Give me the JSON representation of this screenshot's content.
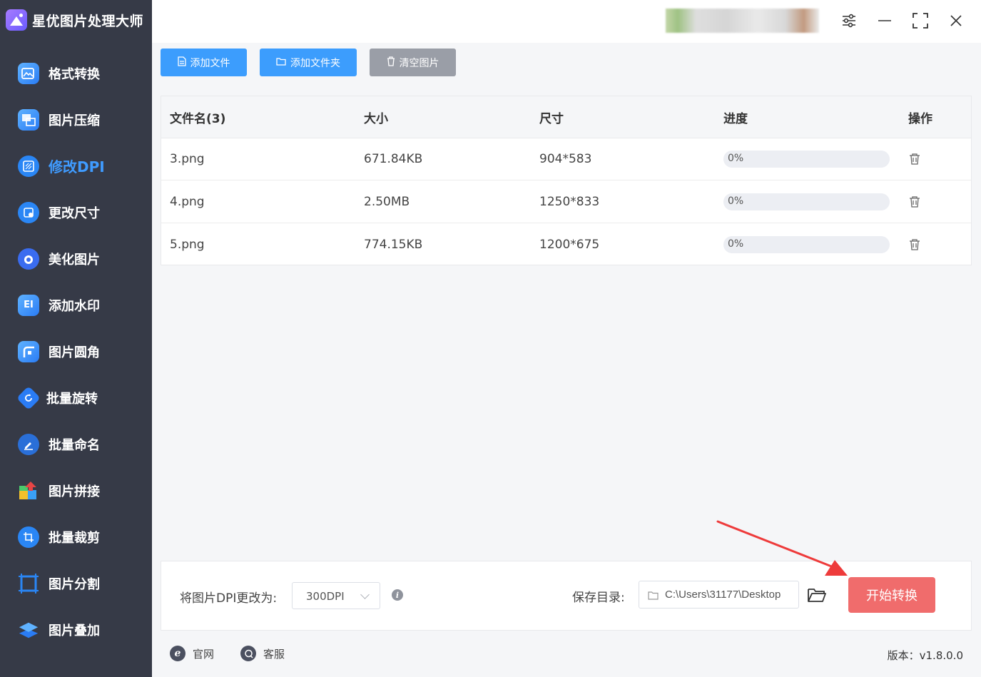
{
  "app": {
    "title": "星优图片处理大师"
  },
  "sidebar": {
    "items": [
      {
        "label": "格式转换",
        "icon": "format-convert-icon",
        "active": false
      },
      {
        "label": "图片压缩",
        "icon": "compress-icon",
        "active": false
      },
      {
        "label": "修改DPI",
        "icon": "dpi-icon",
        "active": true
      },
      {
        "label": "更改尺寸",
        "icon": "resize-icon",
        "active": false
      },
      {
        "label": "美化图片",
        "icon": "beautify-icon",
        "active": false
      },
      {
        "label": "添加水印",
        "icon": "watermark-icon",
        "active": false
      },
      {
        "label": "图片圆角",
        "icon": "rounded-corner-icon",
        "active": false
      },
      {
        "label": "批量旋转",
        "icon": "rotate-icon",
        "active": false
      },
      {
        "label": "批量命名",
        "icon": "rename-icon",
        "active": false
      },
      {
        "label": "图片拼接",
        "icon": "stitch-icon",
        "active": false
      },
      {
        "label": "批量裁剪",
        "icon": "crop-icon",
        "active": false
      },
      {
        "label": "图片分割",
        "icon": "split-icon",
        "active": false
      },
      {
        "label": "图片叠加",
        "icon": "overlay-icon",
        "active": false
      }
    ]
  },
  "toolbar": {
    "add_file": "添加文件",
    "add_folder": "添加文件夹",
    "clear": "清空图片"
  },
  "table": {
    "headers": {
      "name": "文件名(3)",
      "size": "大小",
      "dimensions": "尺寸",
      "progress": "进度",
      "action": "操作"
    },
    "rows": [
      {
        "name": "3.png",
        "size": "671.84KB",
        "dimensions": "904*583",
        "progress_text": "0%",
        "progress": 0
      },
      {
        "name": "4.png",
        "size": "2.50MB",
        "dimensions": "1250*833",
        "progress_text": "0%",
        "progress": 0
      },
      {
        "name": "5.png",
        "size": "774.15KB",
        "dimensions": "1200*675",
        "progress_text": "0%",
        "progress": 0
      }
    ]
  },
  "settings": {
    "dpi_label": "将图片DPI更改为:",
    "dpi_value": "300DPI",
    "save_label": "保存目录:",
    "save_path": "C:\\Users\\31177\\Desktop",
    "start_button": "开始转换"
  },
  "footer": {
    "website": "官网",
    "support": "客服",
    "version": "版本：v1.8.0.0"
  },
  "colors": {
    "sidebar_bg": "#363a47",
    "accent_blue": "#3c9dfd",
    "start_red": "#f06c6c",
    "arrow_red": "#ee3b3b"
  }
}
